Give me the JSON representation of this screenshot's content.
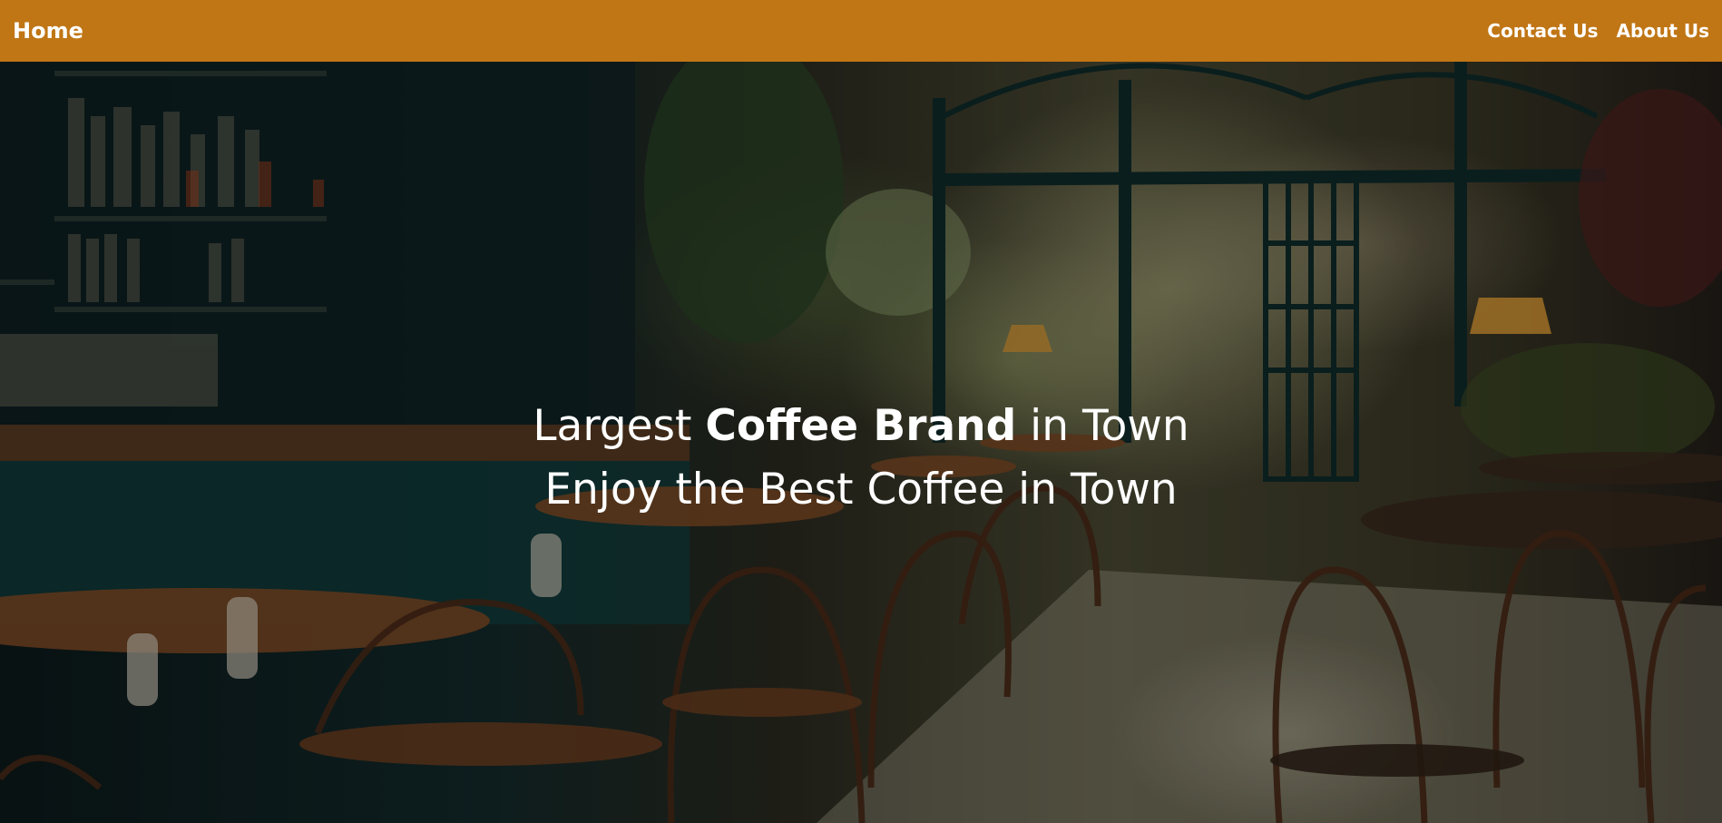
{
  "nav": {
    "home_label": "Home",
    "links": [
      {
        "label": "Contact Us"
      },
      {
        "label": "About Us"
      }
    ],
    "background_color": "#c07615"
  },
  "hero": {
    "title_part1": "Largest ",
    "title_bold": "Coffee Brand",
    "title_part2": " in Town",
    "subtitle": "Enjoy the Best Coffee in Town",
    "background_image": "cafe interior with wooden tables, bentwood chairs, plants and large windows"
  }
}
